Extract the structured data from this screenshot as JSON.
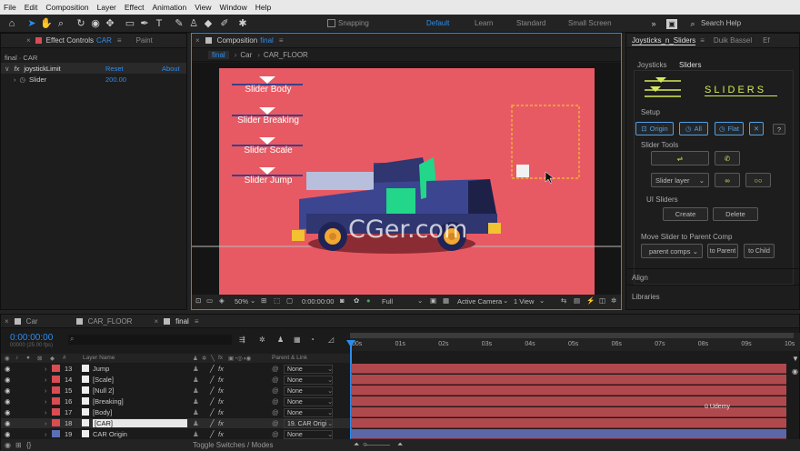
{
  "menu": [
    "File",
    "Edit",
    "Composition",
    "Layer",
    "Effect",
    "Animation",
    "View",
    "Window",
    "Help"
  ],
  "toolbar": {
    "snapping": "Snapping",
    "workspaces": [
      "Default",
      "Learn",
      "Standard",
      "Small Screen"
    ],
    "search_placeholder": "Search Help"
  },
  "effect_controls": {
    "tab": "Effect Controls",
    "tab_comp": "CAR",
    "tab2": "Paint",
    "subtitle": "final · CAR",
    "effect_name": "joystickLimit",
    "reset": "Reset",
    "about": "About",
    "slider_label": "Slider",
    "slider_value": "200.00"
  },
  "composition": {
    "tab": "Composition",
    "tab_name": "final",
    "breadcrumbs": [
      "final",
      "Car",
      "CAR_FLOOR"
    ],
    "labels": [
      "Slider Body",
      "Slider Breaking",
      "Slider Scale",
      "Slider Jump"
    ],
    "watermark": "CGer.com",
    "zoom": "50%",
    "timecode": "0:00:00:00",
    "resolution": "Full",
    "camera": "Active Camera",
    "view": "1 View"
  },
  "right_panel": {
    "tab": "Joysticks_n_Sliders",
    "tab2": "Duik Bassel",
    "tab3": "Ef",
    "subtabs": [
      "Joysticks",
      "Sliders"
    ],
    "logo": "SLIDERS",
    "setup": "Setup",
    "origin": "Origin",
    "all": "All",
    "flat": "Flat",
    "q": "?",
    "slider_tools": "Slider Tools",
    "slider_layer": "Slider layer",
    "ui_sliders": "UI Sliders",
    "create": "Create",
    "delete": "Delete",
    "move_label": "Move Slider to Parent Comp",
    "parent_comps": "parent comps",
    "to_parent": "to Parent",
    "to_child": "to Child",
    "align": "Align",
    "libraries": "Libraries"
  },
  "timeline": {
    "tabs": [
      "Car",
      "CAR_FLOOR",
      "final"
    ],
    "timecode": "0:00:00:00",
    "fps": "00000 (25.00 fps)",
    "col_layer": "Layer Name",
    "col_parent": "Parent & Link",
    "rulers": [
      "00s",
      "01s",
      "02s",
      "03s",
      "04s",
      "05s",
      "06s",
      "07s",
      "08s",
      "09s",
      "10s"
    ],
    "toggle": "Toggle Switches / Modes",
    "udemy": "Udemy",
    "layers": [
      {
        "num": "13",
        "name": "Jump",
        "parent": "None",
        "color": "#d94c52"
      },
      {
        "num": "14",
        "name": "[Scale]",
        "parent": "None",
        "color": "#d94c52"
      },
      {
        "num": "15",
        "name": "[Null 2]",
        "parent": "None",
        "color": "#d94c52"
      },
      {
        "num": "16",
        "name": "[Breaking]",
        "parent": "None",
        "color": "#d94c52"
      },
      {
        "num": "17",
        "name": "[Body]",
        "parent": "None",
        "color": "#d94c52"
      },
      {
        "num": "18",
        "name": "[CAR]",
        "parent": "19. CAR Origi",
        "color": "#d94c52"
      },
      {
        "num": "19",
        "name": "CAR Origin",
        "parent": "None",
        "color": "#5a6fb5"
      }
    ]
  }
}
